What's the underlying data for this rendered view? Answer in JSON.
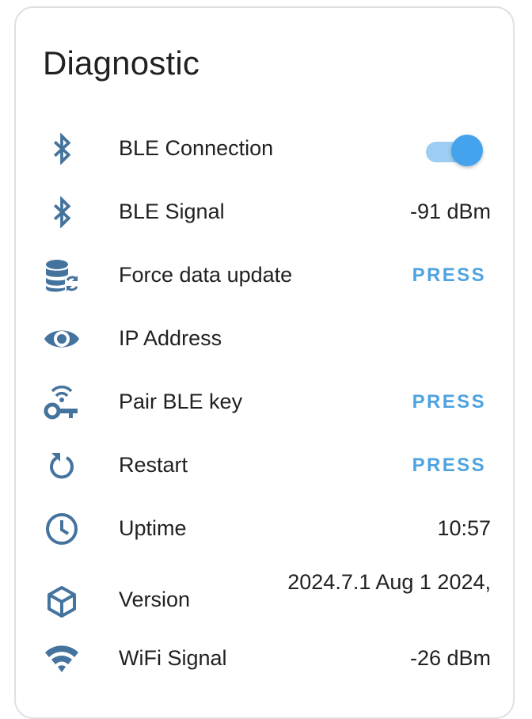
{
  "card": {
    "title": "Diagnostic"
  },
  "colors": {
    "icon": "#44739e",
    "accent": "#4fa3e0",
    "toggle_on": "#44a3ec"
  },
  "rows": [
    {
      "label": "BLE Connection",
      "icon": "bluetooth-icon",
      "control": "toggle",
      "state": "on"
    },
    {
      "label": "BLE Signal",
      "icon": "bluetooth-icon",
      "value": "-91 dBm"
    },
    {
      "label": "Force data update",
      "icon": "database-refresh-icon",
      "action": "PRESS"
    },
    {
      "label": "IP Address",
      "icon": "eye-icon",
      "value": ""
    },
    {
      "label": "Pair BLE key",
      "icon": "key-wireless-icon",
      "action": "PRESS"
    },
    {
      "label": "Restart",
      "icon": "restart-icon",
      "action": "PRESS"
    },
    {
      "label": "Uptime",
      "icon": "clock-icon",
      "value": "10:57"
    },
    {
      "label": "Version",
      "icon": "cube-icon",
      "value": "2024.7.1 Aug 1 2024,"
    },
    {
      "label": "WiFi Signal",
      "icon": "wifi-icon",
      "value": "-26 dBm"
    }
  ]
}
